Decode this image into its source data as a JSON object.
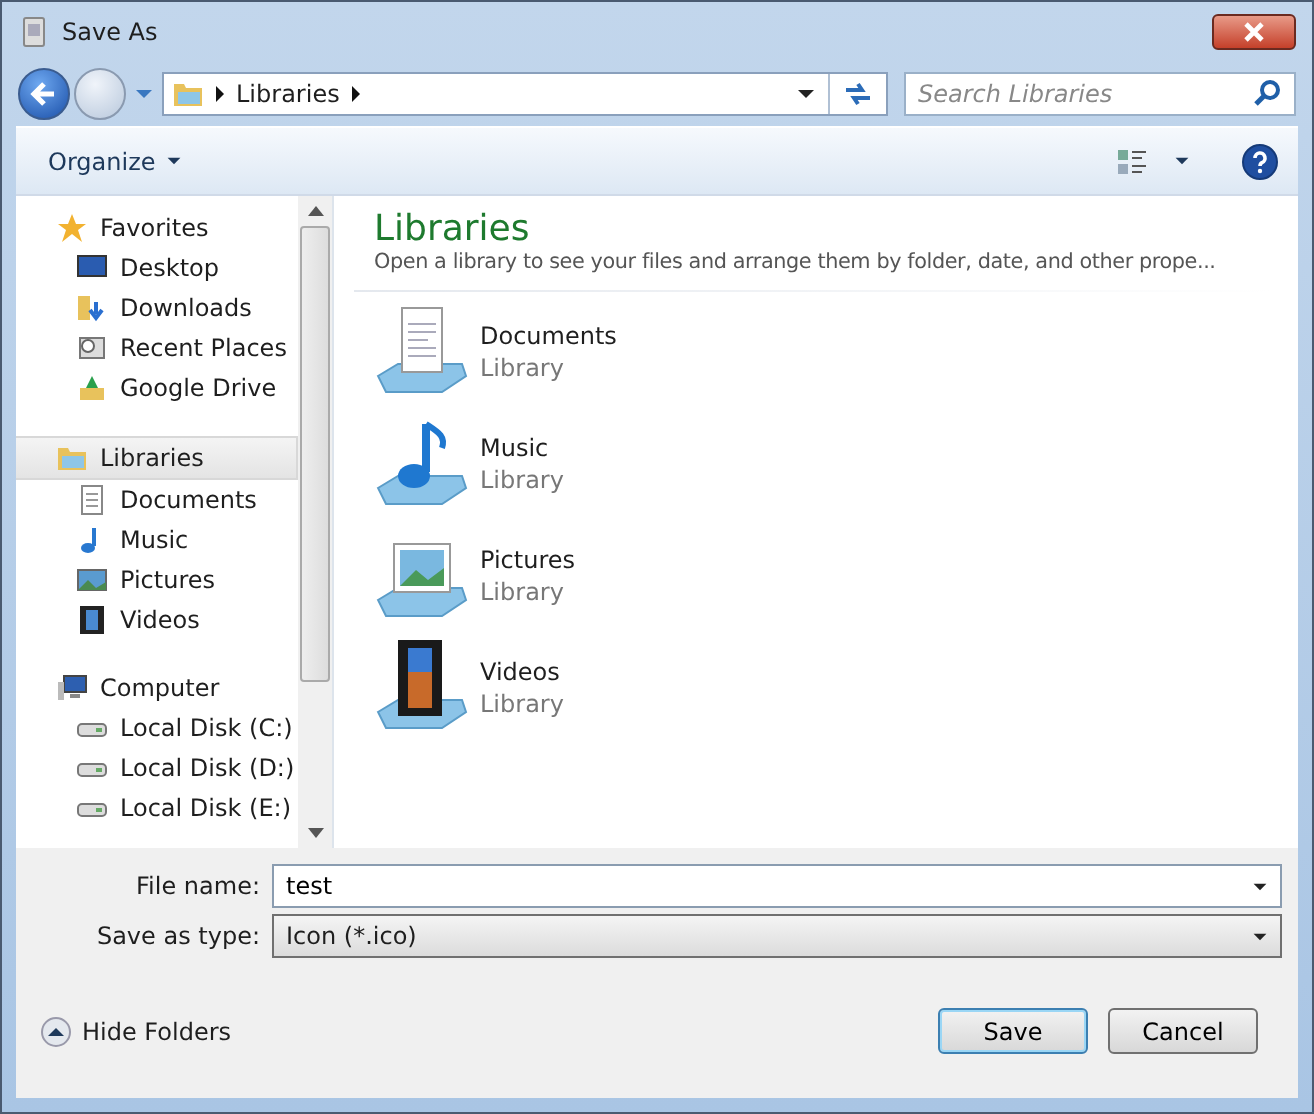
{
  "window": {
    "title": "Save As"
  },
  "address": {
    "crumbs": [
      "Libraries"
    ]
  },
  "search": {
    "placeholder": "Search Libraries"
  },
  "toolbar": {
    "organize": "Organize"
  },
  "sidebar": {
    "groups": [
      {
        "label": "Favorites",
        "selected": false,
        "children": [
          {
            "label": "Desktop",
            "selected": false
          },
          {
            "label": "Downloads",
            "selected": false
          },
          {
            "label": "Recent Places",
            "selected": false
          },
          {
            "label": "Google Drive",
            "selected": false
          }
        ]
      },
      {
        "label": "Libraries",
        "selected": true,
        "children": [
          {
            "label": "Documents",
            "selected": false
          },
          {
            "label": "Music",
            "selected": false
          },
          {
            "label": "Pictures",
            "selected": false
          },
          {
            "label": "Videos",
            "selected": false
          }
        ]
      },
      {
        "label": "Computer",
        "selected": false,
        "children": [
          {
            "label": "Local Disk (C:)",
            "selected": false
          },
          {
            "label": "Local Disk (D:)",
            "selected": false
          },
          {
            "label": "Local Disk (E:)",
            "selected": false
          }
        ]
      }
    ]
  },
  "content": {
    "title": "Libraries",
    "subtitle": "Open a library to see your files and arrange them by folder, date, and other prope...",
    "items": [
      {
        "name": "Documents",
        "type": "Library"
      },
      {
        "name": "Music",
        "type": "Library"
      },
      {
        "name": "Pictures",
        "type": "Library"
      },
      {
        "name": "Videos",
        "type": "Library"
      }
    ]
  },
  "form": {
    "file_name_label": "File name:",
    "file_name": "test",
    "type_label": "Save as type:",
    "type": "Icon (*.ico)"
  },
  "footer": {
    "hide_folders": "Hide Folders",
    "buttons": [
      "Save",
      "Cancel"
    ]
  }
}
